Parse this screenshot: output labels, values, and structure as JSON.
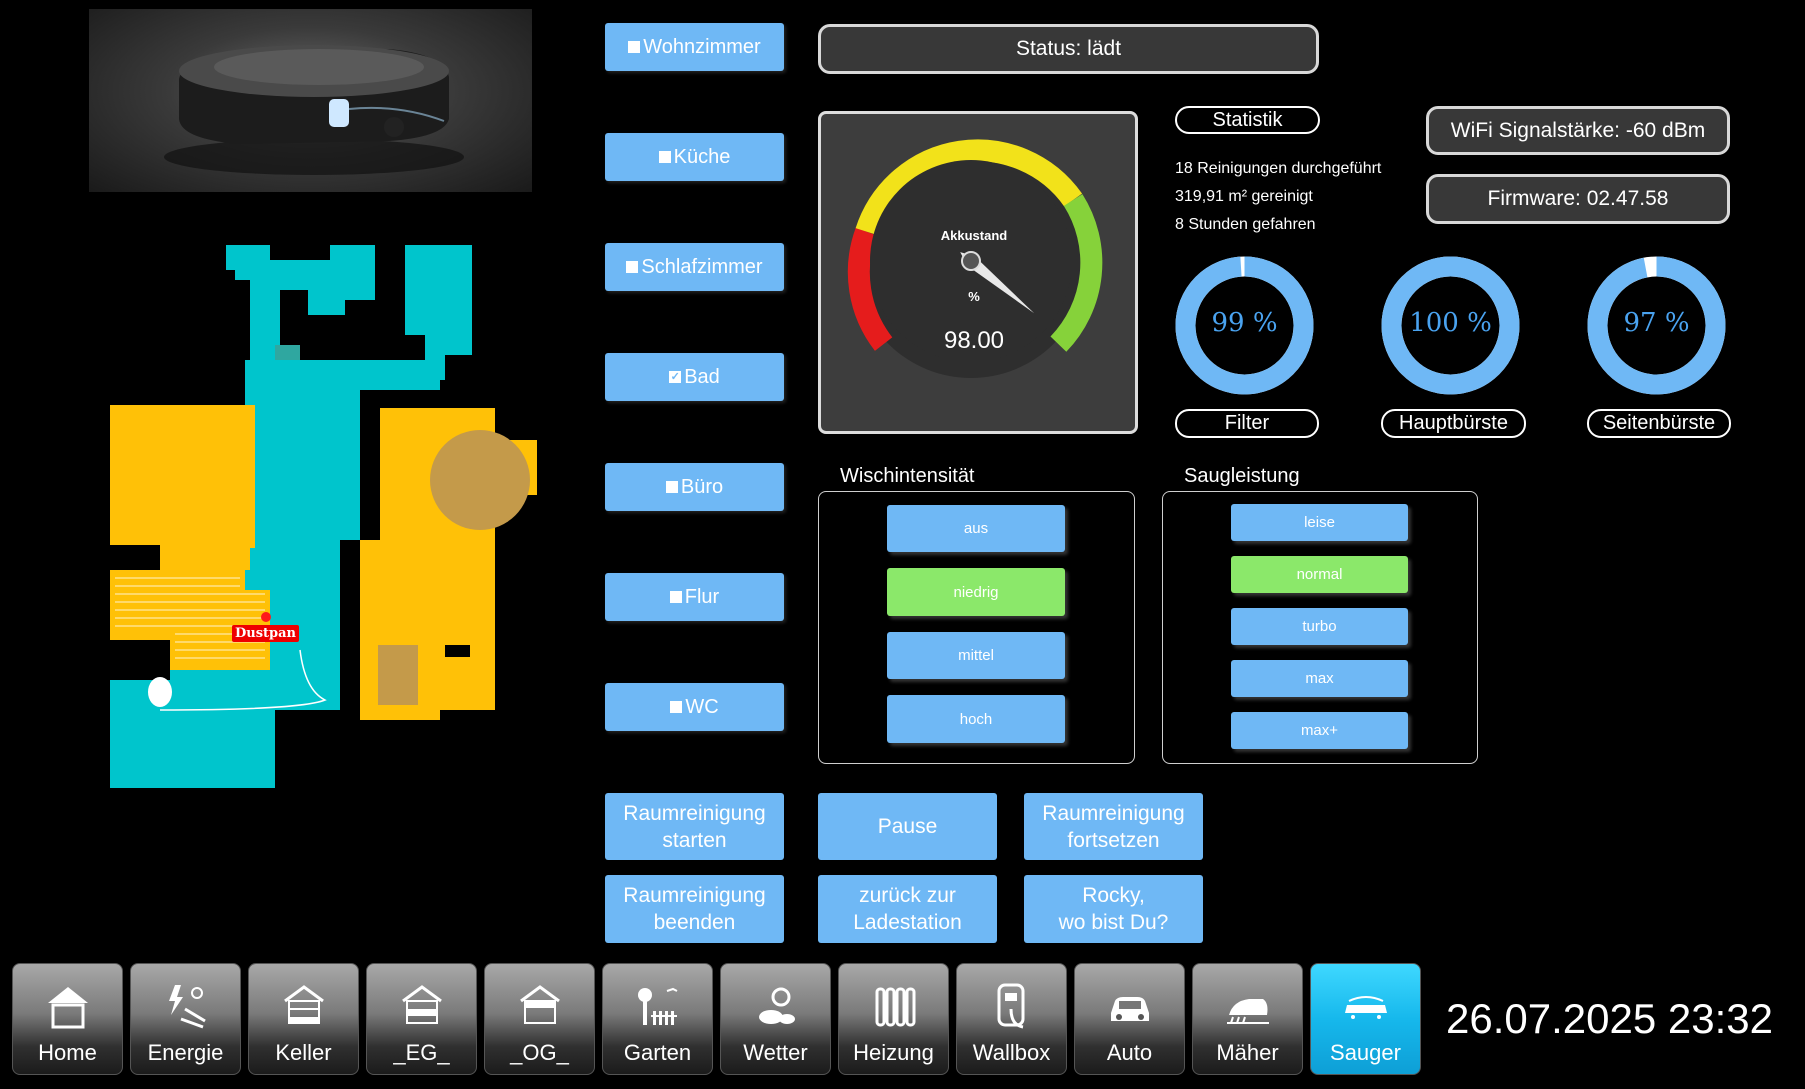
{
  "status": "Status: lädt",
  "rooms": [
    {
      "label": "Wohnzimmer",
      "checked": false
    },
    {
      "label": "Küche",
      "checked": false
    },
    {
      "label": "Schlafzimmer",
      "checked": false
    },
    {
      "label": "Bad",
      "checked": true
    },
    {
      "label": "Büro",
      "checked": false
    },
    {
      "label": "Flur",
      "checked": false
    },
    {
      "label": "WC",
      "checked": false
    }
  ],
  "gauge": {
    "label": "Akkustand",
    "unit": "%",
    "value": "98.00",
    "value_num": 98
  },
  "stats": {
    "title": "Statistik",
    "lines": [
      "18 Reinigungen durchgeführt",
      "319,91 m² gereinigt",
      "8 Stunden gefahren"
    ]
  },
  "wifi": "WiFi Signalstärke: -60 dBm",
  "firmware": "Firmware: 02.47.58",
  "wear": [
    {
      "label": "Filter",
      "text": "99 %",
      "value": 99
    },
    {
      "label": "Hauptbürste",
      "text": "100 %",
      "value": 100
    },
    {
      "label": "Seitenbürste",
      "text": "97 %",
      "value": 97
    }
  ],
  "wisch": {
    "title": "Wischintensität",
    "options": [
      "aus",
      "niedrig",
      "mittel",
      "hoch"
    ],
    "selected": "niedrig"
  },
  "saug": {
    "title": "Saugleistung",
    "options": [
      "leise",
      "normal",
      "turbo",
      "max",
      "max+"
    ],
    "selected": "normal"
  },
  "actions": [
    "Raumreinigung\nstarten",
    "Pause",
    "Raumreinigung\nfortsetzen",
    "Raumreinigung\nbeenden",
    "zurück zur\nLadestation",
    "Rocky,\nwo bist Du?"
  ],
  "map": {
    "dock_label": "Dustpan"
  },
  "nav": [
    {
      "label": "Home",
      "icon": "house-icon"
    },
    {
      "label": "Energie",
      "icon": "energy-icon"
    },
    {
      "label": "Keller",
      "icon": "cellar-house-icon"
    },
    {
      "label": "_EG_",
      "icon": "ground-floor-house-icon"
    },
    {
      "label": "_OG_",
      "icon": "upper-floor-house-icon"
    },
    {
      "label": "Garten",
      "icon": "garden-icon"
    },
    {
      "label": "Wetter",
      "icon": "weather-icon"
    },
    {
      "label": "Heizung",
      "icon": "radiator-icon"
    },
    {
      "label": "Wallbox",
      "icon": "wallbox-icon"
    },
    {
      "label": "Auto",
      "icon": "car-icon"
    },
    {
      "label": "Mäher",
      "icon": "mower-icon"
    },
    {
      "label": "Sauger",
      "icon": "vacuum-icon"
    }
  ],
  "nav_active": "Sauger",
  "datetime": "26.07.2025 23:32",
  "colors": {
    "button": "#6fb8f5",
    "active_option": "#8be86a",
    "nav_active": "#16b8ec",
    "map_floor": "#00c5cc",
    "map_room": "#ffc107",
    "donut": "#6fb8f5",
    "value_text": "#4aa3f0"
  }
}
